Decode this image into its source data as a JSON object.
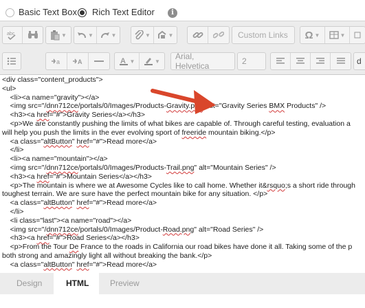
{
  "mode": {
    "basic_label": "Basic Text Box",
    "rich_label": "Rich Text Editor",
    "selected": "Rich Text Editor",
    "info_glyph": "i"
  },
  "toolbar1": {
    "custom_links_label": "Custom Links",
    "omega_glyph": "Ω"
  },
  "toolbar2": {
    "font_family": "Arial, Helvetica",
    "font_size": "2",
    "truncated_label": "d"
  },
  "editor": {
    "lines": [
      [
        {
          "t": "<div class=\"content_products\">"
        }
      ],
      [
        {
          "t": "<ul>"
        }
      ],
      [
        {
          "t": "    <li><a name=\"gravity\"></a>"
        }
      ],
      [
        {
          "t": "    <img src=\"/"
        },
        {
          "t": "dnn712ce",
          "sq": true
        },
        {
          "t": "/portals/0/Images/Products-"
        },
        {
          "t": "Gravity.png",
          "sq": true
        },
        {
          "t": "\" alt=\"Gravity Series "
        },
        {
          "t": "BMX",
          "sq": true
        },
        {
          "t": " Products\" />"
        }
      ],
      [
        {
          "t": "    <h3><a "
        },
        {
          "t": "href",
          "sq": true
        },
        {
          "t": "=\"#\">Gravity Series</a></h3>"
        }
      ],
      [
        {
          "t": "    <p>We are constantly pushing the limits of what bikes are capable of. Through careful testing, evaluation a"
        }
      ],
      [
        {
          "t": "will help you push the limits in the ever evolving sport of "
        },
        {
          "t": "freeride",
          "sq": true
        },
        {
          "t": " mountain biking.</p>"
        }
      ],
      [
        {
          "t": "    <a class=\""
        },
        {
          "t": "altButton",
          "sq": true
        },
        {
          "t": "\" "
        },
        {
          "t": "href",
          "sq": true
        },
        {
          "t": "=\"#\">Read more</a>"
        }
      ],
      [
        {
          "t": "    </li>"
        }
      ],
      [
        {
          "t": "    <li><a name=\"mountain\"></a>"
        }
      ],
      [
        {
          "t": "    <img src=\"/"
        },
        {
          "t": "dnn712ce",
          "sq": true
        },
        {
          "t": "/portals/0/Images/Products-"
        },
        {
          "t": "Trail.png",
          "sq": true
        },
        {
          "t": "\" alt=\"Mountain Series\" />"
        }
      ],
      [
        {
          "t": "    <h3><a "
        },
        {
          "t": "href",
          "sq": true
        },
        {
          "t": "=\"#\">Mountain Series</a></h3>"
        }
      ],
      [
        {
          "t": "    <p>The mountain is where we at Awesome Cycles like to call home. Whether it&"
        },
        {
          "t": "rsquo",
          "sq": true
        },
        {
          "t": ";s a short ride through"
        }
      ],
      [
        {
          "t": "toughest terrain. We are sure have the perfect mountain bike for any situation. </p>"
        }
      ],
      [
        {
          "t": "    <a class=\""
        },
        {
          "t": "altButton",
          "sq": true
        },
        {
          "t": "\" "
        },
        {
          "t": "href",
          "sq": true
        },
        {
          "t": "=\"#\">Read more</a>"
        }
      ],
      [
        {
          "t": "    </li>"
        }
      ],
      [
        {
          "t": "    <li class=\"last\"><a name=\"road\"></a>"
        }
      ],
      [
        {
          "t": "    <img src=\"/"
        },
        {
          "t": "dnn712ce",
          "sq": true
        },
        {
          "t": "/portals/0/Images/Product-"
        },
        {
          "t": "Road.png",
          "sq": true
        },
        {
          "t": "\" alt=\"Road Series\" />"
        }
      ],
      [
        {
          "t": "    <h3><a "
        },
        {
          "t": "href",
          "sq": true
        },
        {
          "t": "=\"#\">Road Series</a></h3>"
        }
      ],
      [
        {
          "t": "    <p>From the Tour "
        },
        {
          "t": "De",
          "sq": true
        },
        {
          "t": " France to the roads in California our road bikes have done it all. Taking some of the p"
        }
      ],
      [
        {
          "t": "both strong and amazingly light all without breaking the bank.</p>"
        }
      ],
      [
        {
          "t": "    <a class=\""
        },
        {
          "t": "altButton",
          "sq": true
        },
        {
          "t": "\" "
        },
        {
          "t": "href",
          "sq": true
        },
        {
          "t": "=\"#\">Read more</a>"
        }
      ]
    ]
  },
  "tabs": {
    "design": "Design",
    "html": "HTML",
    "preview": "Preview",
    "active": "HTML"
  },
  "colors": {
    "arrow": "#d9462b",
    "spellcheck": "#d23a3a",
    "toolbar_bg": "#ececec"
  }
}
